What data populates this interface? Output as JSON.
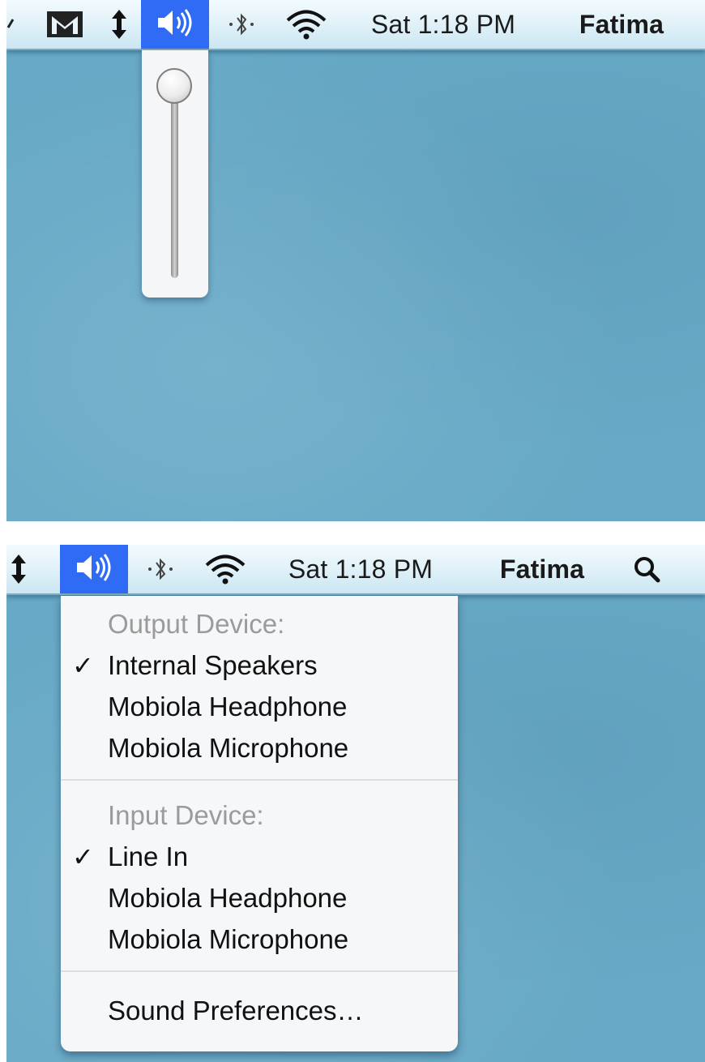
{
  "colors": {
    "desktop": "#67a9c6",
    "menubar": "#e2f2f9",
    "highlight": "#2f6bf4",
    "menu_bg": "#f5f7f9",
    "header_text": "#9b9b9b"
  },
  "top_panel": {
    "menubar": {
      "icons": [
        "script-icon",
        "gmail-icon",
        "sync-arrows-icon",
        "volume-icon",
        "bluetooth-icon",
        "wifi-icon"
      ],
      "clock": "Sat 1:18 PM",
      "user": "Fatima"
    },
    "volume_slider": {
      "level": 1.0
    }
  },
  "bottom_panel": {
    "menubar": {
      "icons": [
        "sync-arrows-icon",
        "volume-icon",
        "bluetooth-icon",
        "wifi-icon",
        "spotlight-search-icon"
      ],
      "clock": "Sat 1:18 PM",
      "user": "Fatima"
    },
    "sound_menu": {
      "output_header": "Output Device:",
      "output_items": [
        {
          "label": "Internal Speakers",
          "check": "✓"
        },
        {
          "label": "Mobiola Headphone",
          "check": ""
        },
        {
          "label": "Mobiola Microphone",
          "check": ""
        }
      ],
      "input_header": "Input Device:",
      "input_items": [
        {
          "label": "Line In",
          "check": "✓"
        },
        {
          "label": "Mobiola Headphone",
          "check": ""
        },
        {
          "label": "Mobiola Microphone",
          "check": ""
        }
      ],
      "preferences_label": "Sound Preferences…"
    }
  }
}
